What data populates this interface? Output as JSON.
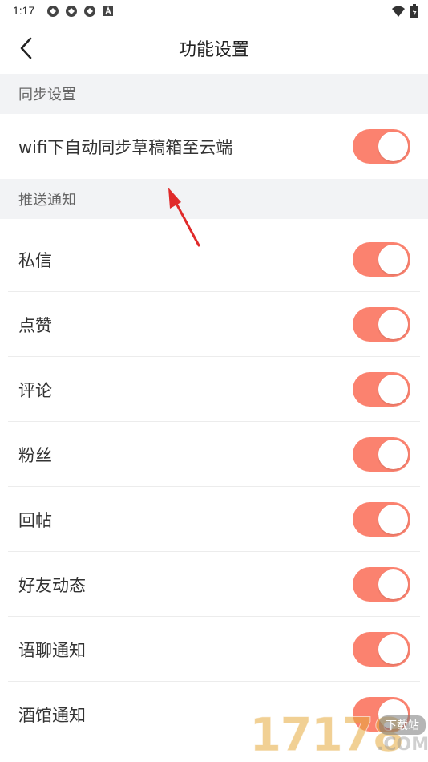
{
  "status_bar": {
    "time": "1:17",
    "icons": [
      "app-icon",
      "app-icon",
      "app-icon",
      "a-badge-icon"
    ],
    "right_icons": [
      "wifi-icon",
      "battery-icon"
    ]
  },
  "header": {
    "title": "功能设置",
    "back_icon": "chevron-left-icon"
  },
  "sections": [
    {
      "title": "同步设置",
      "items": [
        {
          "label": "wifi下自动同步草稿箱至云端",
          "enabled": true
        }
      ]
    },
    {
      "title": "推送通知",
      "items": [
        {
          "label": "私信",
          "enabled": true
        },
        {
          "label": "点赞",
          "enabled": true
        },
        {
          "label": "评论",
          "enabled": true
        },
        {
          "label": "粉丝",
          "enabled": true
        },
        {
          "label": "回帖",
          "enabled": true
        },
        {
          "label": "好友动态",
          "enabled": true
        },
        {
          "label": "语聊通知",
          "enabled": true
        },
        {
          "label": "酒馆通知",
          "enabled": true
        }
      ]
    }
  ],
  "colors": {
    "toggle_on": "#fb826f",
    "section_bg": "#f2f3f5",
    "annotation_arrow": "#e02a2a"
  },
  "watermark": {
    "digits": "17178",
    "tag": "下载站",
    "com": ".COM"
  }
}
